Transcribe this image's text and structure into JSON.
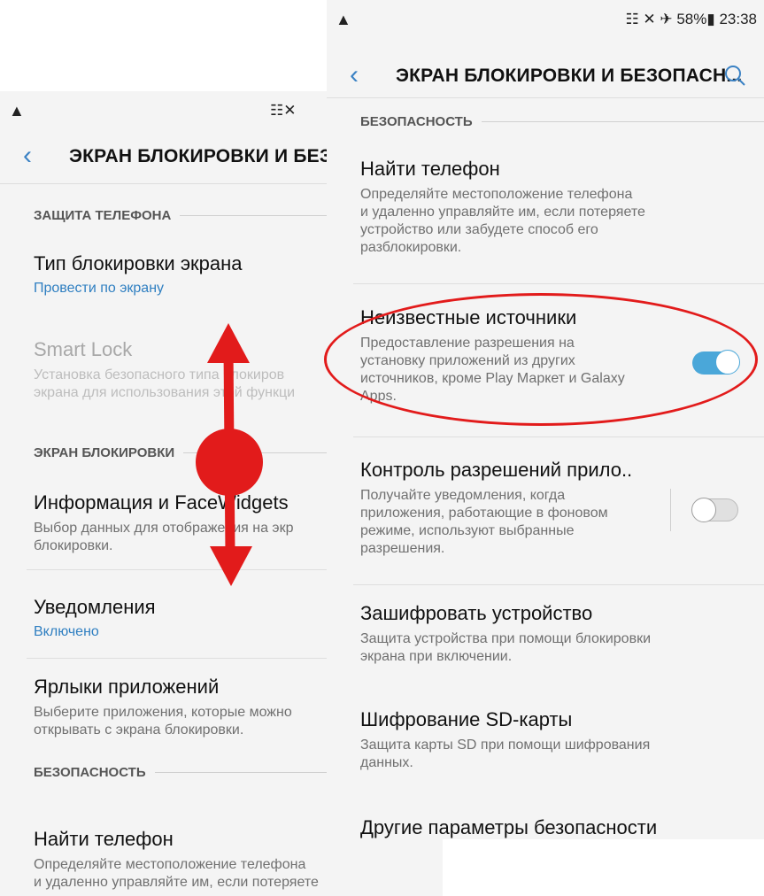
{
  "left": {
    "status": {
      "warning_icon": "warning-triangle-icon",
      "icons": "☷✕"
    },
    "appbar": {
      "back_icon": "back-chevron-icon",
      "title": "ЭКРАН БЛОКИРОВКИ И БЕЗОП"
    },
    "sections": [
      {
        "label": "ЗАЩИТА ТЕЛЕФОНА"
      },
      {
        "label": "ЭКРАН БЛОКИРОВКИ"
      },
      {
        "label": "БЕЗОПАСНОСТЬ"
      }
    ],
    "items": [
      {
        "title": "Тип блокировки экрана",
        "value": "Провести по экрану"
      },
      {
        "title": "Smart Lock",
        "subtitle": "Установка безопасного типа блокиров\nэкрана для использования этой функци"
      },
      {
        "title": "Информация и FaceWidgets",
        "subtitle": "Выбор данных для отображения на экр\nблокировки."
      },
      {
        "title": "Уведомления",
        "value": "Включено"
      },
      {
        "title": "Ярлыки приложений",
        "subtitle": "Выберите приложения, которые можно\nоткрывать с экрана блокировки."
      },
      {
        "title": "Найти телефон",
        "subtitle": "Определяйте местоположение телефона\nи удаленно управляйте им, если потеряете"
      }
    ]
  },
  "right": {
    "status": {
      "warning_icon": "warning-triangle-icon",
      "icons": "☷ ✕ ✈ 58%▮ 23:38"
    },
    "appbar": {
      "back_icon": "back-chevron-icon",
      "title": "ЭКРАН БЛОКИРОВКИ И БЕЗОПАСН...",
      "search_icon": "search-icon"
    },
    "section": "БЕЗОПАСНОСТЬ",
    "items": [
      {
        "title": "Найти телефон",
        "subtitle": "Определяйте местоположение телефона\nи удаленно управляйте им, если потеряете\nустройство или забудете способ его\nразблокировки."
      },
      {
        "title": "Неизвестные источники",
        "subtitle": "Предоставление разрешения на\nустановку приложений из других\nисточников, кроме Play Маркет и Galaxy\nApps.",
        "toggle_on": true
      },
      {
        "title": "Контроль разрешений прило..",
        "subtitle": "Получайте уведомления, когда\nприложения, работающие в фоновом\nрежиме, используют выбранные\nразрешения.",
        "toggle_on": false
      },
      {
        "title": "Зашифровать устройство",
        "subtitle": "Защита устройства при помощи блокировки\nэкрана при включении."
      },
      {
        "title": "Шифрование SD-карты",
        "subtitle": "Защита карты SD при помощи шифрования\nданных."
      },
      {
        "title": "Другие параметры безопасности"
      }
    ]
  },
  "annotations": {
    "highlight_color": "#e21b1b",
    "scroll_gesture_icon": "scroll-gesture-arrow-icon"
  },
  "colors": {
    "accent": "#3b82c4",
    "toggle_on": "#4aa7d9",
    "background": "#f4f4f4"
  }
}
